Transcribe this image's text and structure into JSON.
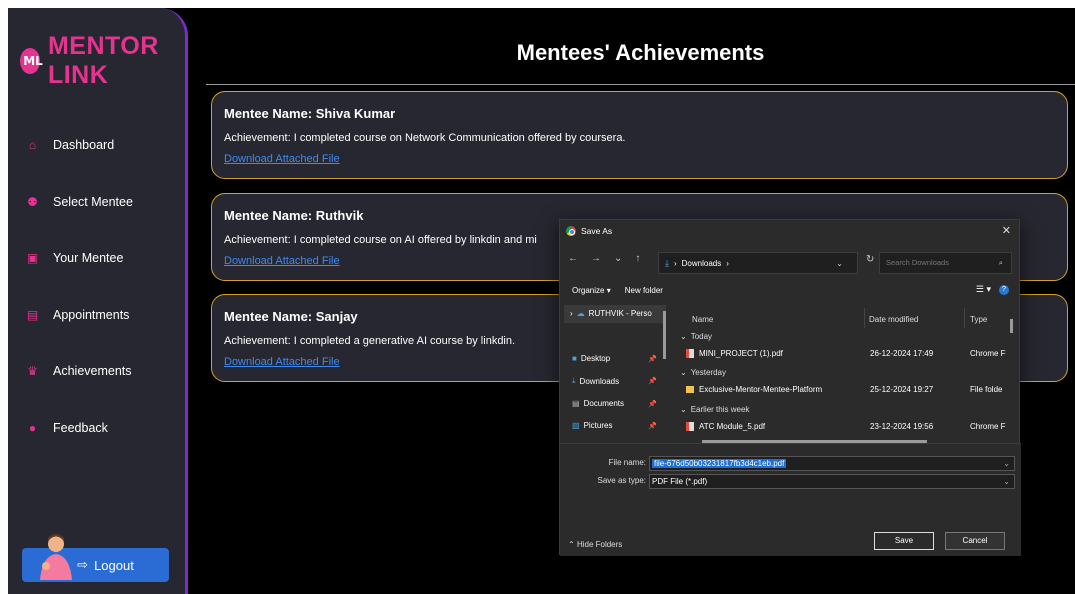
{
  "sidebar": {
    "brand": "MENTOR LINK",
    "items": [
      {
        "label": "Dashboard",
        "icon": "home-icon"
      },
      {
        "label": "Select Mentee",
        "icon": "users-icon"
      },
      {
        "label": "Your Mentee",
        "icon": "chat-icon"
      },
      {
        "label": "Appointments",
        "icon": "clipboard-icon"
      },
      {
        "label": "Achievements",
        "icon": "trophy-icon"
      },
      {
        "label": "Feedback",
        "icon": "user-icon"
      }
    ],
    "logout": "Logout"
  },
  "main": {
    "title": "Mentees' Achievements",
    "cards": [
      {
        "name": "Mentee Name: Shiva Kumar",
        "achievement": "Achievement: I completed course on Network Communication offered by coursera.",
        "link": "Download Attached File"
      },
      {
        "name": "Mentee Name: Ruthvik",
        "achievement": "Achievement: I completed course on AI offered by linkdin and mi",
        "link": "Download Attached File"
      },
      {
        "name": "Mentee Name: Sanjay",
        "achievement": "Achievement: I completed a generative AI course by linkdin.",
        "link": "Download Attached File"
      }
    ]
  },
  "dialog": {
    "title": "Save As",
    "address": "Downloads",
    "search_placeholder": "Search Downloads",
    "organize": "Organize",
    "new_folder": "New folder",
    "nav_items": [
      "RUTHVIK - Perso",
      "Desktop",
      "Downloads",
      "Documents",
      "Pictures"
    ],
    "columns": [
      "Name",
      "Date modified",
      "Type"
    ],
    "groups": [
      "Today",
      "Yesterday",
      "Earlier this week"
    ],
    "files": [
      {
        "name": "MINI_PROJECT (1).pdf",
        "date": "26-12-2024 17:49",
        "type": "Chrome F",
        "kind": "pdf"
      },
      {
        "name": "Exclusive-Mentor-Mentee-Platform",
        "date": "25-12-2024 19:27",
        "type": "File folde",
        "kind": "folder"
      },
      {
        "name": "ATC Module_5.pdf",
        "date": "23-12-2024 19:56",
        "type": "Chrome F",
        "kind": "pdf"
      }
    ],
    "file_name_label": "File name:",
    "file_name_value": "file-676d50b03231817fb3d4c1eb.pdf",
    "save_type_label": "Save as type:",
    "save_type_value": "PDF File (*.pdf)",
    "hide_folders": "Hide Folders",
    "save": "Save",
    "cancel": "Cancel"
  },
  "colors": {
    "brand": "#e6338f",
    "card_border": "#d4a22b",
    "link": "#3d8bf2",
    "sidebar_border": "#7b2bd1",
    "logout_bg": "#2b6cd4"
  }
}
